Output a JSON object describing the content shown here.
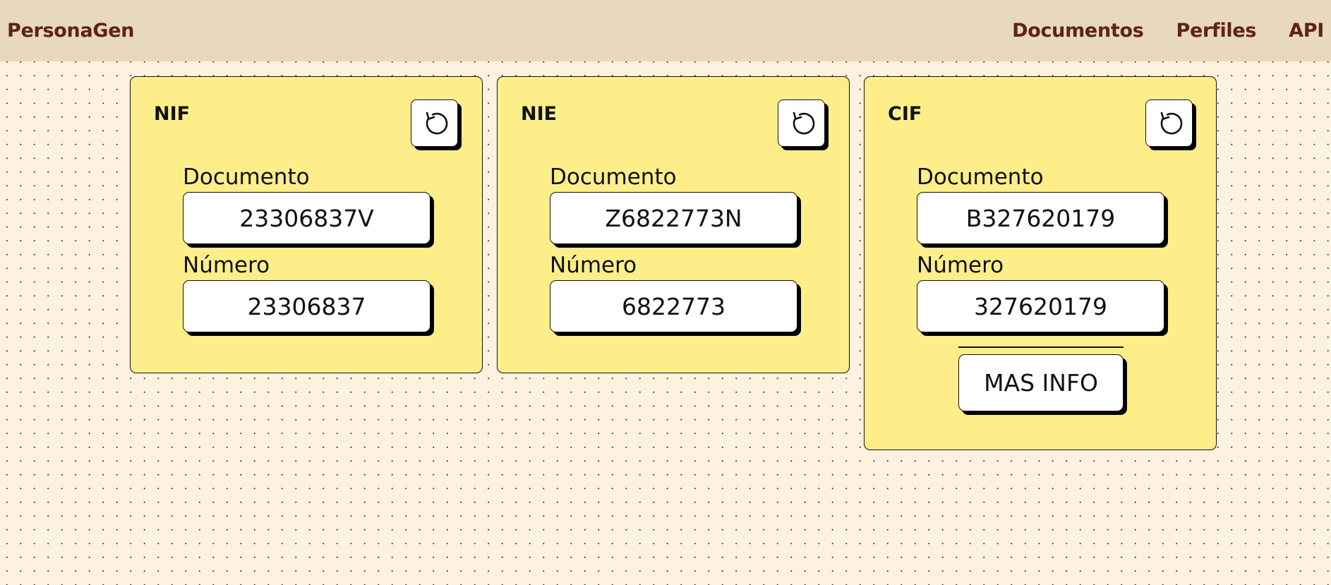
{
  "navbar": {
    "brand": "PersonaGen",
    "links": [
      {
        "label": "Documentos"
      },
      {
        "label": "Perfiles"
      },
      {
        "label": "API"
      }
    ]
  },
  "cards": [
    {
      "title": "NIF",
      "refresh_icon": "refresh-icon",
      "documento_label": "Documento",
      "documento_value": "23306837V",
      "numero_label": "Número",
      "numero_value": "23306837"
    },
    {
      "title": "NIE",
      "refresh_icon": "refresh-icon",
      "documento_label": "Documento",
      "documento_value": "Z6822773N",
      "numero_label": "Número",
      "numero_value": "6822773"
    },
    {
      "title": "CIF",
      "refresh_icon": "refresh-icon",
      "documento_label": "Documento",
      "documento_value": "B327620179",
      "numero_label": "Número",
      "numero_value": "327620179",
      "more_label": "MAS INFO"
    }
  ],
  "colors": {
    "background": "#fdf1df",
    "navbar": "#e8d8bd",
    "nav_text": "#5c2414",
    "card": "#fdee8a"
  }
}
